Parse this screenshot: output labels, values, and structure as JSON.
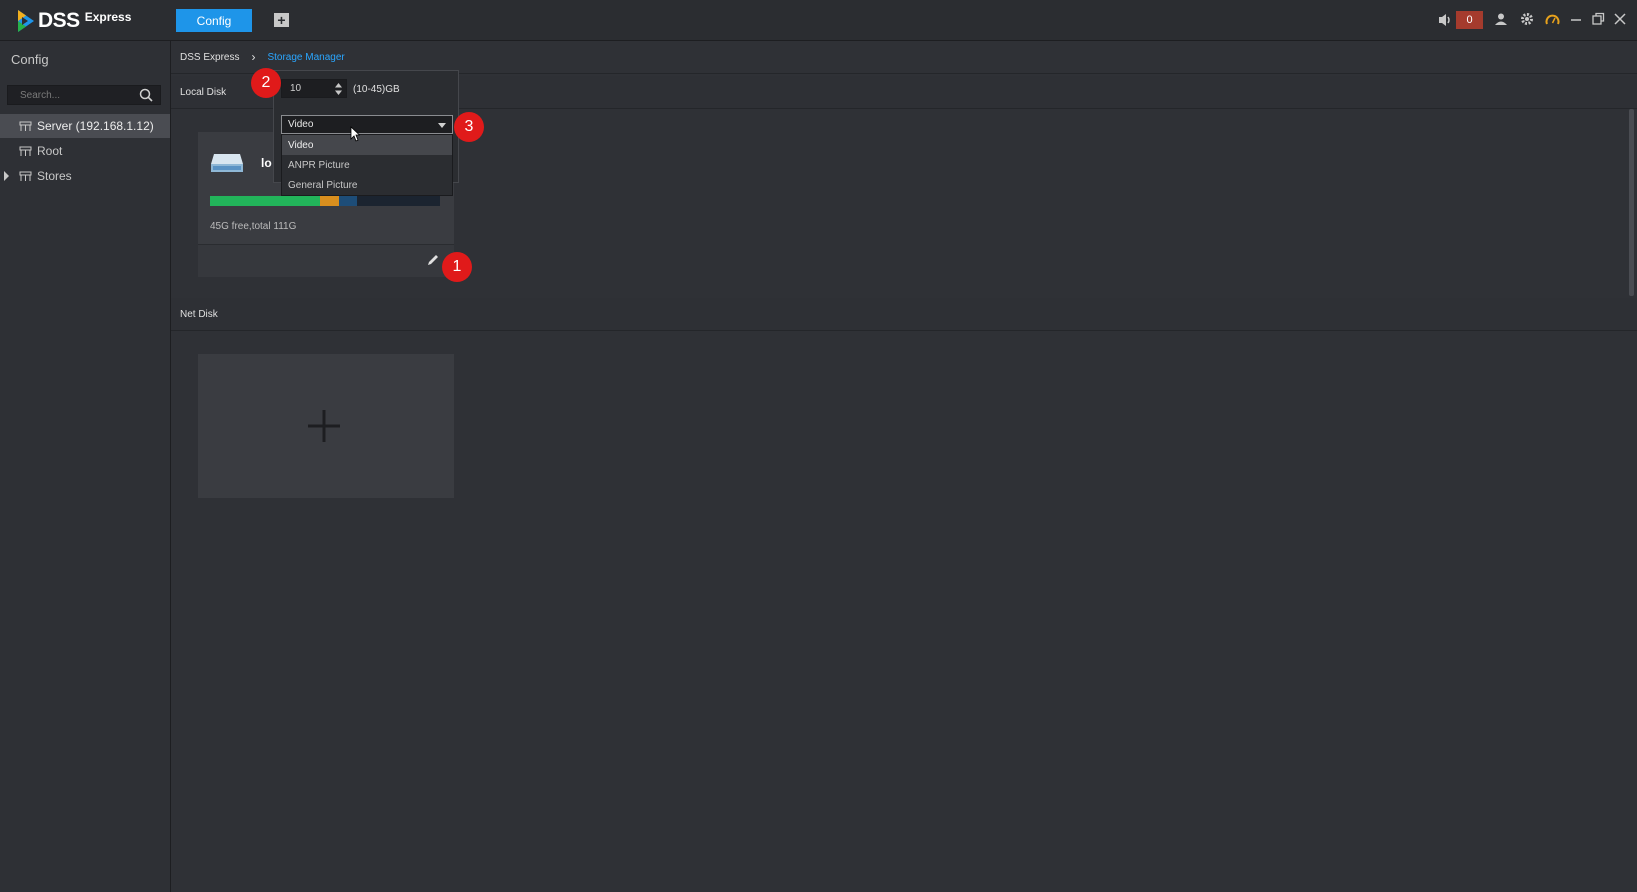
{
  "app": {
    "logo_text": "DSS",
    "logo_sub": "Express",
    "tabs": [
      {
        "label": "Config",
        "active": true
      }
    ],
    "add_tab_icon": "plus-icon",
    "alarm_count": "0",
    "accent_color": "#1e95e9"
  },
  "sidebar": {
    "title": "Config",
    "search_placeholder": "Search...",
    "items": [
      {
        "label": "Server (192.168.1.12)",
        "icon": "server-icon",
        "selected": true
      },
      {
        "label": "Root",
        "icon": "org-icon",
        "selected": false
      },
      {
        "label": "Stores",
        "icon": "org-icon",
        "selected": false,
        "expandable": true
      }
    ]
  },
  "breadcrumb": {
    "home": "DSS Express",
    "current": "Storage Manager"
  },
  "local_disk": {
    "header": "Local Disk",
    "disk": {
      "name": "lo",
      "info": "45G free,total 111G",
      "usage": {
        "green_pct": 48,
        "orange_pct": 8,
        "blue_pct": 8
      },
      "colors": {
        "green": "#22b45a",
        "orange": "#d98f1e",
        "blue": "#1d4d78"
      }
    }
  },
  "popover": {
    "quota_value": "10",
    "quota_range": "(10-45)GB",
    "selected_type": "Video",
    "options": [
      "Video",
      "ANPR Picture",
      "General Picture"
    ]
  },
  "net_disk": {
    "header": "Net Disk",
    "add_icon": "plus-icon"
  },
  "annotations": [
    "1",
    "2",
    "3"
  ]
}
